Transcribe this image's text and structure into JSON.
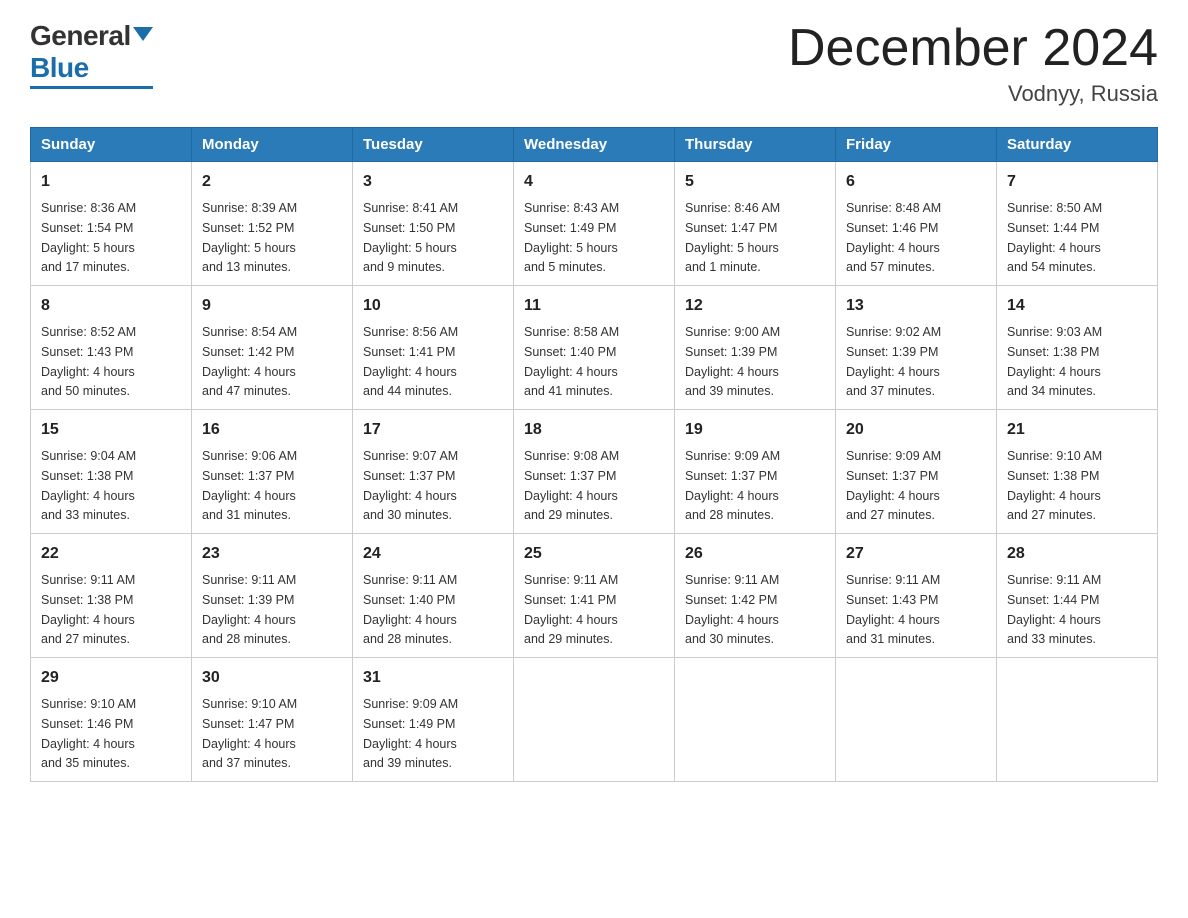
{
  "header": {
    "logo_general": "General",
    "logo_blue": "Blue",
    "month_title": "December 2024",
    "location": "Vodnyy, Russia"
  },
  "weekdays": [
    "Sunday",
    "Monday",
    "Tuesday",
    "Wednesday",
    "Thursday",
    "Friday",
    "Saturday"
  ],
  "weeks": [
    [
      {
        "day": "1",
        "sunrise": "8:36 AM",
        "sunset": "1:54 PM",
        "daylight": "5 hours and 17 minutes."
      },
      {
        "day": "2",
        "sunrise": "8:39 AM",
        "sunset": "1:52 PM",
        "daylight": "5 hours and 13 minutes."
      },
      {
        "day": "3",
        "sunrise": "8:41 AM",
        "sunset": "1:50 PM",
        "daylight": "5 hours and 9 minutes."
      },
      {
        "day": "4",
        "sunrise": "8:43 AM",
        "sunset": "1:49 PM",
        "daylight": "5 hours and 5 minutes."
      },
      {
        "day": "5",
        "sunrise": "8:46 AM",
        "sunset": "1:47 PM",
        "daylight": "5 hours and 1 minute."
      },
      {
        "day": "6",
        "sunrise": "8:48 AM",
        "sunset": "1:46 PM",
        "daylight": "4 hours and 57 minutes."
      },
      {
        "day": "7",
        "sunrise": "8:50 AM",
        "sunset": "1:44 PM",
        "daylight": "4 hours and 54 minutes."
      }
    ],
    [
      {
        "day": "8",
        "sunrise": "8:52 AM",
        "sunset": "1:43 PM",
        "daylight": "4 hours and 50 minutes."
      },
      {
        "day": "9",
        "sunrise": "8:54 AM",
        "sunset": "1:42 PM",
        "daylight": "4 hours and 47 minutes."
      },
      {
        "day": "10",
        "sunrise": "8:56 AM",
        "sunset": "1:41 PM",
        "daylight": "4 hours and 44 minutes."
      },
      {
        "day": "11",
        "sunrise": "8:58 AM",
        "sunset": "1:40 PM",
        "daylight": "4 hours and 41 minutes."
      },
      {
        "day": "12",
        "sunrise": "9:00 AM",
        "sunset": "1:39 PM",
        "daylight": "4 hours and 39 minutes."
      },
      {
        "day": "13",
        "sunrise": "9:02 AM",
        "sunset": "1:39 PM",
        "daylight": "4 hours and 37 minutes."
      },
      {
        "day": "14",
        "sunrise": "9:03 AM",
        "sunset": "1:38 PM",
        "daylight": "4 hours and 34 minutes."
      }
    ],
    [
      {
        "day": "15",
        "sunrise": "9:04 AM",
        "sunset": "1:38 PM",
        "daylight": "4 hours and 33 minutes."
      },
      {
        "day": "16",
        "sunrise": "9:06 AM",
        "sunset": "1:37 PM",
        "daylight": "4 hours and 31 minutes."
      },
      {
        "day": "17",
        "sunrise": "9:07 AM",
        "sunset": "1:37 PM",
        "daylight": "4 hours and 30 minutes."
      },
      {
        "day": "18",
        "sunrise": "9:08 AM",
        "sunset": "1:37 PM",
        "daylight": "4 hours and 29 minutes."
      },
      {
        "day": "19",
        "sunrise": "9:09 AM",
        "sunset": "1:37 PM",
        "daylight": "4 hours and 28 minutes."
      },
      {
        "day": "20",
        "sunrise": "9:09 AM",
        "sunset": "1:37 PM",
        "daylight": "4 hours and 27 minutes."
      },
      {
        "day": "21",
        "sunrise": "9:10 AM",
        "sunset": "1:38 PM",
        "daylight": "4 hours and 27 minutes."
      }
    ],
    [
      {
        "day": "22",
        "sunrise": "9:11 AM",
        "sunset": "1:38 PM",
        "daylight": "4 hours and 27 minutes."
      },
      {
        "day": "23",
        "sunrise": "9:11 AM",
        "sunset": "1:39 PM",
        "daylight": "4 hours and 28 minutes."
      },
      {
        "day": "24",
        "sunrise": "9:11 AM",
        "sunset": "1:40 PM",
        "daylight": "4 hours and 28 minutes."
      },
      {
        "day": "25",
        "sunrise": "9:11 AM",
        "sunset": "1:41 PM",
        "daylight": "4 hours and 29 minutes."
      },
      {
        "day": "26",
        "sunrise": "9:11 AM",
        "sunset": "1:42 PM",
        "daylight": "4 hours and 30 minutes."
      },
      {
        "day": "27",
        "sunrise": "9:11 AM",
        "sunset": "1:43 PM",
        "daylight": "4 hours and 31 minutes."
      },
      {
        "day": "28",
        "sunrise": "9:11 AM",
        "sunset": "1:44 PM",
        "daylight": "4 hours and 33 minutes."
      }
    ],
    [
      {
        "day": "29",
        "sunrise": "9:10 AM",
        "sunset": "1:46 PM",
        "daylight": "4 hours and 35 minutes."
      },
      {
        "day": "30",
        "sunrise": "9:10 AM",
        "sunset": "1:47 PM",
        "daylight": "4 hours and 37 minutes."
      },
      {
        "day": "31",
        "sunrise": "9:09 AM",
        "sunset": "1:49 PM",
        "daylight": "4 hours and 39 minutes."
      },
      null,
      null,
      null,
      null
    ]
  ],
  "labels": {
    "sunrise": "Sunrise:",
    "sunset": "Sunset:",
    "daylight": "Daylight:"
  }
}
